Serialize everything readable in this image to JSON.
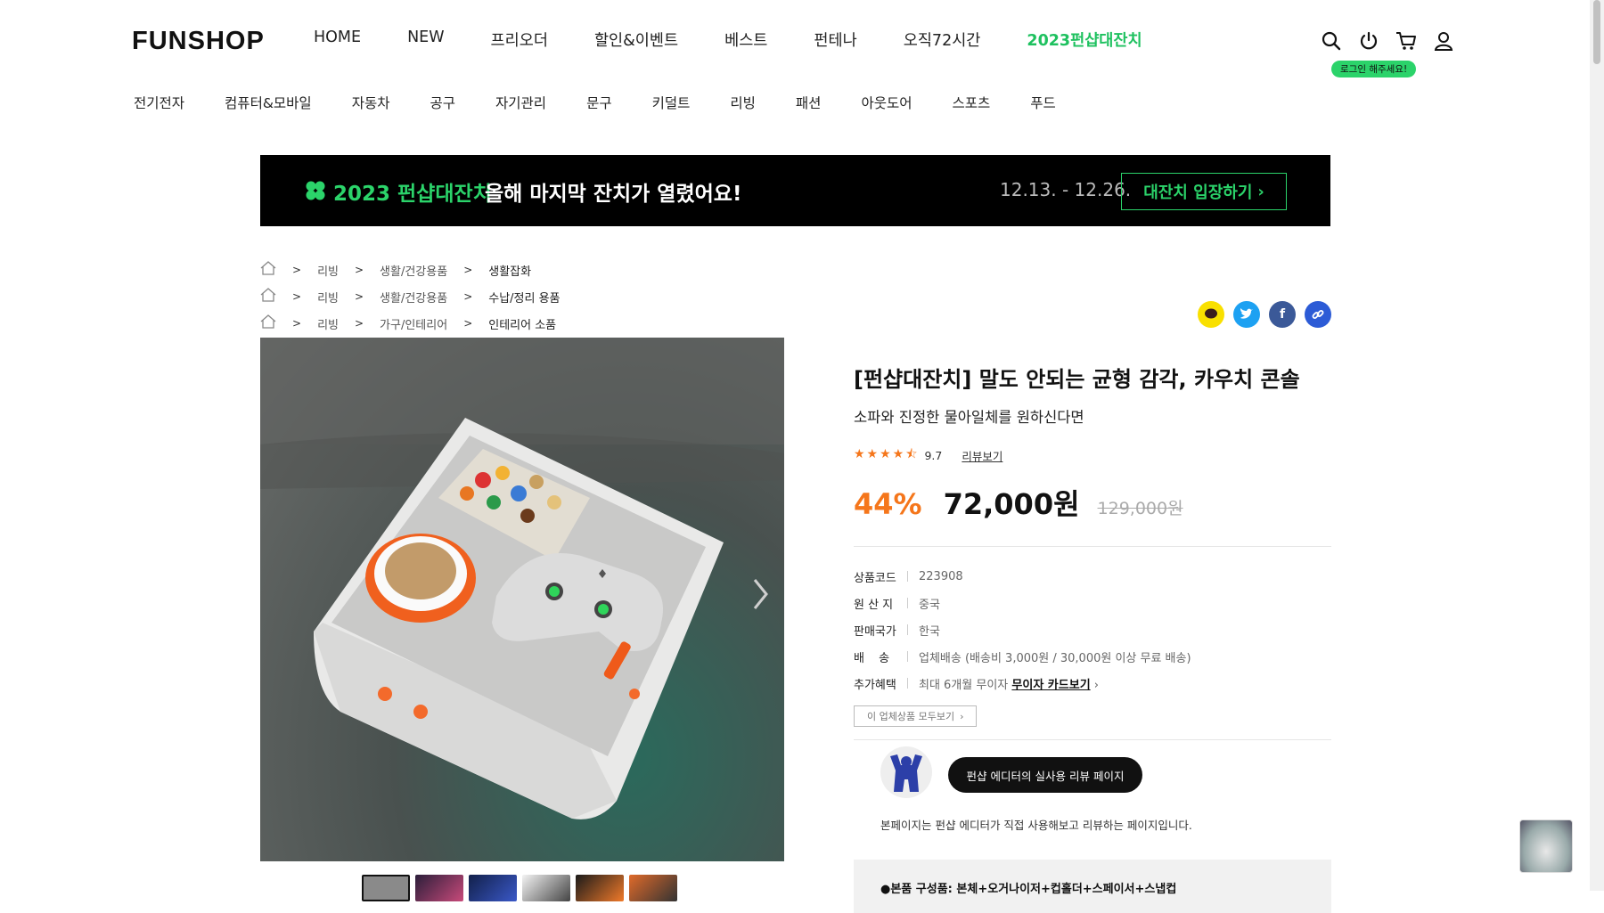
{
  "header": {
    "logo": "FUNSHOP",
    "gnb": [
      "HOME",
      "NEW",
      "프리오더",
      "할인&이벤트",
      "베스트",
      "펀테나",
      "오직72시간"
    ],
    "gnb_accent": "2023펀샵대잔치",
    "login_tooltip": "로그인 해주세요!",
    "categories": [
      "전기전자",
      "컴퓨터&모바일",
      "자동차",
      "공구",
      "자기관리",
      "문구",
      "키덜트",
      "리빙",
      "패션",
      "아웃도어",
      "스포츠",
      "푸드"
    ],
    "icons": [
      "search-icon",
      "power-icon",
      "cart-icon",
      "user-icon"
    ]
  },
  "banner": {
    "title": "2023 펀샵대잔치",
    "subtitle": "올해 마지막 잔치가 열렸어요!",
    "date": "12.13. - 12.26.",
    "button": "대잔치 입장하기"
  },
  "breadcrumbs": [
    [
      "리빙",
      "생활/건강용품",
      "생활잡화"
    ],
    [
      "리빙",
      "생활/건강용품",
      "수납/정리 용품"
    ],
    [
      "리빙",
      "가구/인테리어",
      "인테리어 소품"
    ]
  ],
  "product": {
    "title": "[펀샵대잔치] 말도 안되는 균형 감각, 카우치 콘솔",
    "subtitle": "소파와 진정한 물아일체를 원하신다면",
    "rating": "9.7",
    "rating_stars": 4.5,
    "review_link": "리뷰보기",
    "discount": "44%",
    "price": "72,000원",
    "original_price": "129,000원",
    "specs": [
      {
        "k": "상품코드",
        "v": "223908"
      },
      {
        "k": "원 산 지",
        "v": "중국"
      },
      {
        "k": "판매국가",
        "v": "한국"
      },
      {
        "k": "배 송",
        "v": "업체배송 (배송비 3,000원 / 30,000원 이상 무료 배송)"
      }
    ],
    "benefit_label": "추가혜택",
    "benefit_text": "최대 6개월 무이자",
    "benefit_link": "무이자 카드보기",
    "all_products": "이 업체상품 모두보기",
    "editor_button": "펀샵 에디터의 실사용 리뷰 페이지",
    "editor_note": "본페이지는 펀샵 에디터가 직접 사용해보고 리뷰하는 페이지입니다.",
    "composition": "●본품 구성품: 본체+오거나이저+컵홀더+스페이서+스냅컵"
  },
  "colors": {
    "accent_green": "#2bd36a",
    "discount_orange": "#f5761b"
  }
}
